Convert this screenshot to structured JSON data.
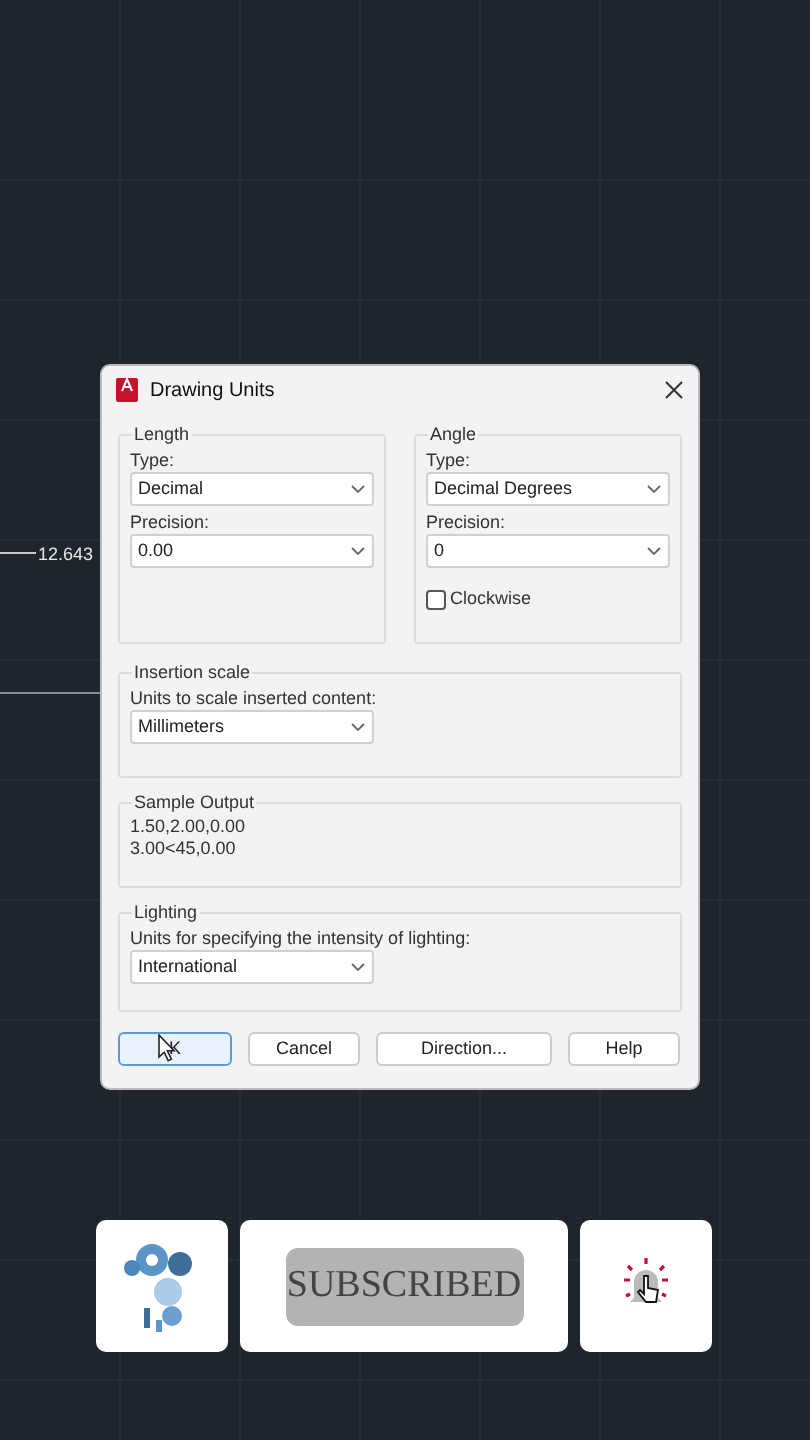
{
  "canvas": {
    "dimension": "12.643"
  },
  "dialog": {
    "title": "Drawing Units",
    "length": {
      "legend": "Length",
      "type_label": "Type:",
      "type_value": "Decimal",
      "precision_label": "Precision:",
      "precision_value": "0.00"
    },
    "angle": {
      "legend": "Angle",
      "type_label": "Type:",
      "type_value": "Decimal Degrees",
      "precision_label": "Precision:",
      "precision_value": "0",
      "clockwise": {
        "label": "Clockwise",
        "checked": false
      }
    },
    "insertion_scale": {
      "legend": "Insertion scale",
      "label": "Units to scale inserted content:",
      "value": "Millimeters"
    },
    "sample_output": {
      "legend": "Sample Output",
      "lines": [
        "1.50,2.00,0.00",
        "3.00<45,0.00"
      ]
    },
    "lighting": {
      "legend": "Lighting",
      "label": "Units for specifying the intensity of lighting:",
      "value": "International"
    },
    "buttons": [
      {
        "label": "K",
        "focused": true
      },
      {
        "label": "Cancel",
        "focused": false
      },
      {
        "label": "Direction...",
        "focused": false
      },
      {
        "label": "Help",
        "focused": false
      }
    ]
  },
  "overlay": {
    "subscribe_label": "SUBSCRIBED"
  }
}
